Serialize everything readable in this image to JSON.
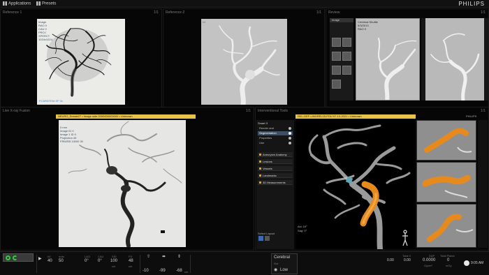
{
  "topbar": {
    "applications": "Applications",
    "presets": "Presets",
    "brand": "PHILIPS"
  },
  "panels": {
    "ref1": {
      "title": "Reference 1",
      "count": "1/1",
      "overlay": "Image\nRAO 0\nCAU 0\nPROJ\nXPERCT\n1024x1024",
      "stamp": "FCARDTEM SF 3x"
    },
    "ref2": {
      "title": "Reference 2",
      "count": "1/1"
    },
    "review": {
      "title": "Review",
      "count": "1/1",
      "header": "Image",
      "overlay": "Cerebral Shuttle\n5/3/2013\nRAO 0"
    },
    "live": {
      "title": "Live X-ray Fusion",
      "count": "1/1",
      "subbar": "NEURO_Sessie27 • Image side 2000000000000 • Unknown",
      "overlay": "0 mm\nImage ID 0\nImage 1 ID 0\nProjection 45\nFRM/SB 13000 30"
    },
    "tools": {
      "title": "Interventional Tools",
      "count": "1/1",
      "subbar": "REL-DEF-LINGREL15-FOU 07-13-2021 • Unknown",
      "corner": "PHILIPS"
    }
  },
  "tool_panel": {
    "heading": "Smart 3",
    "items": [
      "Render and Reconstruction",
      "Segmentation",
      "Properties",
      "Use"
    ],
    "active_index": 1,
    "sections": [
      "Aneurysm Anatomy",
      "Lesions",
      "Vessels",
      "Landmarks",
      "3D Measurements"
    ],
    "footer_label": "Select Layout",
    "views": [
      "Axi: 19°",
      "Sag: 0°"
    ]
  },
  "bottombar": {
    "kv_label": "kV",
    "kv": "40",
    "mas_label": "mAs",
    "mas": "50",
    "angle1_label": "LAO",
    "angle1": "0°",
    "angle2_label": "CAU",
    "angle2": "0°",
    "sid_label": "SID",
    "sid": "100",
    "sid_unit": "cm",
    "fd_label": "FD",
    "fd": "48",
    "fd_unit": "cm",
    "table1": "-10",
    "table2": "-99",
    "table3": "-68",
    "table_unit": "cm",
    "protocol": "Cerebral",
    "protocol_sub": "N/a",
    "dose_mode": "Low",
    "frames1": "0.00",
    "frames2": "0.00",
    "total_label": "Total X",
    "dap_label": "DAP",
    "dap": "0.0000",
    "dap_unit": "Gycm²",
    "total_plates_label": "Total Plates",
    "total_plates": "0",
    "total_unit": "mGy",
    "time": "9:05 AM"
  },
  "colors": {
    "accent": "#e8c34a",
    "go": "#2bd13b",
    "vessel_highlight": "#e78a1e"
  }
}
